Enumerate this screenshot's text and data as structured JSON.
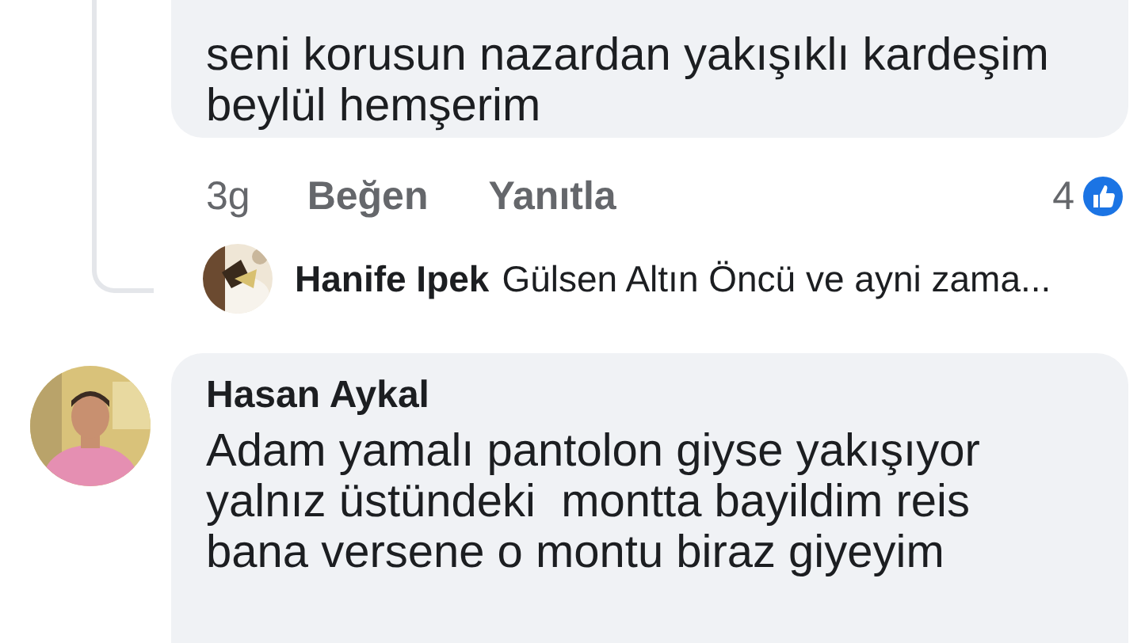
{
  "comments": [
    {
      "lines": [
        "seni korusun nazardan yakışıklı kardeşim",
        "beylül hemşerim"
      ],
      "time": "3g",
      "actions": [
        "Beğen",
        "Yanıtla"
      ],
      "like_count": "4",
      "reply_preview": {
        "author": "Hanife Ipek",
        "text": "Gülsen Altın Öncü ve ayni zama..."
      }
    },
    {
      "author": "Hasan Aykal",
      "lines": [
        "Adam yamalı pantolon giyse yakışıyor",
        "yalnız üstündeki  montta bayildim reis",
        "bana versene o montu biraz giyeyim"
      ]
    }
  ]
}
